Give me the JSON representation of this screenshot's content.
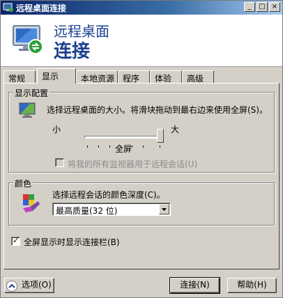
{
  "window": {
    "title": "远程桌面连接",
    "controls": {
      "minimize": "_",
      "maximize": "□",
      "close": "×"
    }
  },
  "banner": {
    "line1": "远程桌面",
    "line2": "连接",
    "icon": "monitor-network-icon"
  },
  "tabs": [
    "常规",
    "显示",
    "本地资源",
    "程序",
    "体验",
    "高级"
  ],
  "active_tab": "显示",
  "display_config": {
    "title": "显示配置",
    "description": "选择远程桌面的大小。将滑块拖动到最右边来使用全屏(S)。",
    "slider_min_label": "小",
    "slider_max_label": "大",
    "slider_value_label": "全屏",
    "slider_value": 1.0,
    "monitors_checkbox_label": "将我的所有监视器用于远程会话(U)",
    "monitors_checkbox_checked": false,
    "monitors_checkbox_disabled": true
  },
  "colors": {
    "title": "颜色",
    "description": "选择远程会话的颜色深度(C)。",
    "selected": "最高质量(32 位)"
  },
  "connection_bar": {
    "label": "全屏显示时显示连接栏(B)",
    "checked": true
  },
  "buttons": {
    "options": "选项(O)",
    "connect": "连接(N)",
    "help": "帮助(H)"
  }
}
